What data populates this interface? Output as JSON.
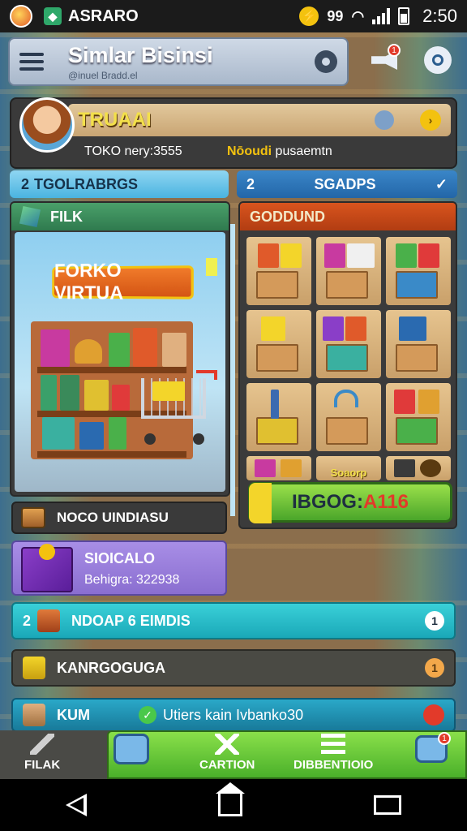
{
  "status_bar": {
    "app_name": "ASRARO",
    "signal_text": "99",
    "time": "2:50",
    "icons": [
      "app-badge-icon",
      "app-square-icon",
      "coin-icon",
      "wifi-icon",
      "signal-icon",
      "battery-icon"
    ]
  },
  "header": {
    "title": "Simlar Bisinsi",
    "subtitle": "@inuel Bradd.el",
    "icons": [
      "menu-icon",
      "gear-icon",
      "megaphone-icon",
      "search-icon"
    ],
    "notif_count": "1"
  },
  "profile": {
    "store_name": "TRUAAI",
    "toko_label": "TOKO nery:3555",
    "status_label": "Nōoudi",
    "status_value": "pusaemtn"
  },
  "tabs": {
    "left_count": "2",
    "left_label": "TGOLRABRGS",
    "right_count": "2",
    "right_label": "SGADPS"
  },
  "left_panel": {
    "header": "FILK",
    "store_sign": "FORKO VIRTUA"
  },
  "right_panel": {
    "header": "GODDUND",
    "tile_label": "Soaorp",
    "price_prefix": "IBGOG:",
    "price_value": "A116"
  },
  "notice": {
    "label": "NOCO UINDIASU"
  },
  "storage": {
    "title": "SIOICALO",
    "sub": "Behigra: 322938"
  },
  "rows": [
    {
      "num": "2",
      "label": "NDOAP 6 EIMDIS",
      "badge": "1"
    },
    {
      "label": "KANRGOGUGA",
      "badge": "1"
    },
    {
      "label": "KUM",
      "mid": "Utiers kain Ivbanko30"
    }
  ],
  "bottom_nav": {
    "items": [
      "FILAK",
      "CARTION",
      "DIBBENTIOIO"
    ],
    "msg_badge": "1"
  },
  "colors": {
    "accent_green": "#4ab02a",
    "accent_orange": "#d8541e",
    "accent_teal": "#1aa8b8",
    "coin_yellow": "#f3c20f"
  }
}
